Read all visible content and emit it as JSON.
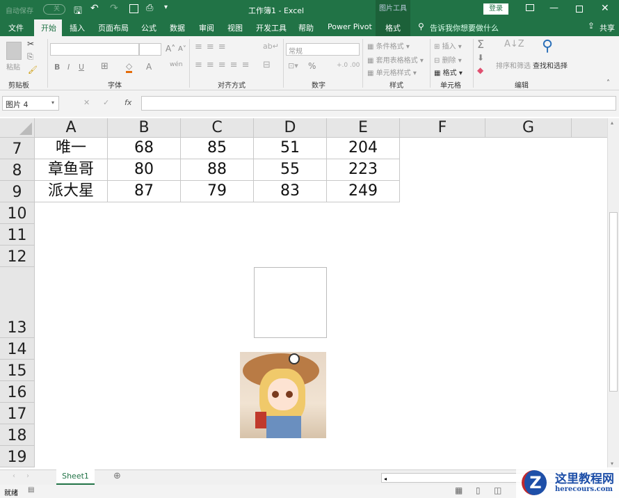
{
  "titlebar": {
    "autosave": "自动保存",
    "autosave_state": "关",
    "title": "工作簿1 - Excel",
    "context_tool": "图片工具",
    "login": "登录"
  },
  "tabs": [
    "文件",
    "开始",
    "插入",
    "页面布局",
    "公式",
    "数据",
    "审阅",
    "视图",
    "开发工具",
    "帮助",
    "Power Pivot",
    "格式"
  ],
  "active_tab": "开始",
  "tellme": "告诉我你想要做什么",
  "share": "共享",
  "ribbon": {
    "clipboard": {
      "paste": "粘贴",
      "label": "剪贴板"
    },
    "font": {
      "label": "字体",
      "bold": "B",
      "italic": "I",
      "underline": "U"
    },
    "alignment": {
      "label": "对齐方式"
    },
    "number": {
      "format": "常规",
      "label": "数字",
      "percent": "%"
    },
    "styles": {
      "conditional": "条件格式",
      "table": "套用表格格式",
      "cell": "单元格样式",
      "label": "样式"
    },
    "cells": {
      "insert": "插入",
      "delete": "删除",
      "format": "格式",
      "label": "单元格"
    },
    "editing": {
      "sort": "排序和筛选",
      "find": "查找和选择",
      "label": "编辑"
    }
  },
  "formula_bar": {
    "name_box": "图片 4",
    "fx": "fx",
    "value": ""
  },
  "columns": [
    "A",
    "B",
    "C",
    "D",
    "E",
    "F",
    "G"
  ],
  "rows": [
    {
      "num": "7",
      "cells": [
        "唯一",
        "68",
        "85",
        "51",
        "204"
      ]
    },
    {
      "num": "8",
      "cells": [
        "章鱼哥",
        "80",
        "88",
        "55",
        "223"
      ]
    },
    {
      "num": "9",
      "cells": [
        "派大星",
        "87",
        "79",
        "83",
        "249"
      ]
    },
    {
      "num": "10",
      "cells": []
    },
    {
      "num": "11",
      "cells": []
    },
    {
      "num": "12",
      "cells": []
    },
    {
      "num": "13",
      "cells": []
    },
    {
      "num": "14",
      "cells": []
    },
    {
      "num": "15",
      "cells": []
    },
    {
      "num": "16",
      "cells": []
    },
    {
      "num": "17",
      "cells": []
    },
    {
      "num": "18",
      "cells": []
    },
    {
      "num": "19",
      "cells": []
    }
  ],
  "sheet_tab": "Sheet1",
  "status": "就绪",
  "watermark": {
    "name": "这里教程网",
    "url": "herecours.com"
  }
}
